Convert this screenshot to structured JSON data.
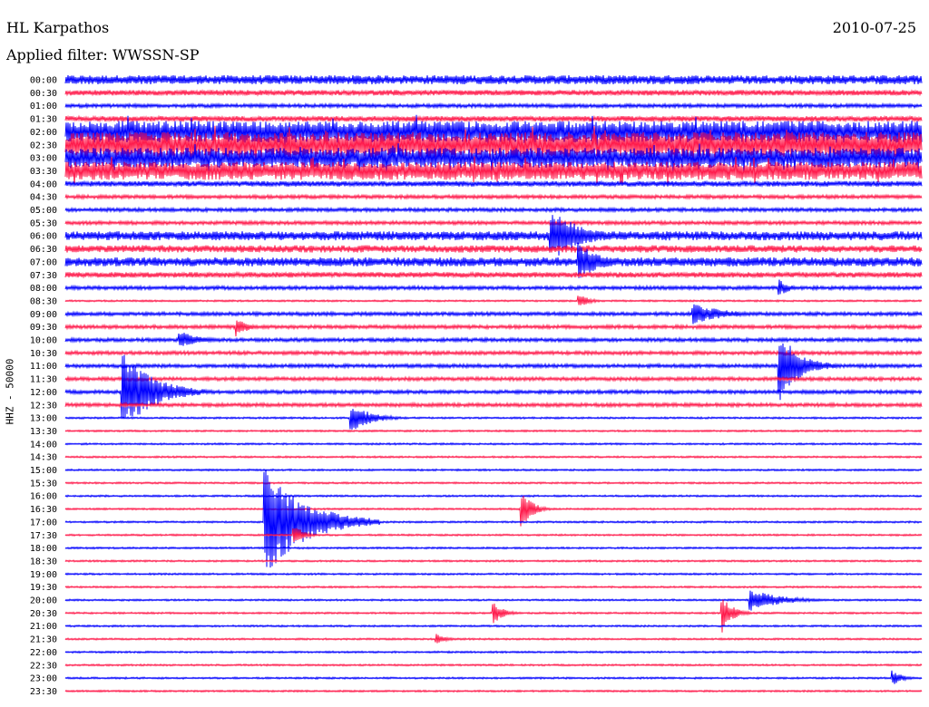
{
  "header": {
    "station": "HL Karpathos",
    "date": "2010-07-25",
    "filter_label": "Applied filter: WWSSN-SP"
  },
  "chart_data": {
    "type": "helicorder",
    "ylabel": "HHZ - 50000",
    "row_minutes": 30,
    "colors": [
      "#0000ff",
      "#ff1a4b"
    ],
    "rows": [
      "00:00",
      "00:30",
      "01:00",
      "01:30",
      "02:00",
      "02:30",
      "03:00",
      "03:30",
      "04:00",
      "04:30",
      "05:00",
      "05:30",
      "06:00",
      "06:30",
      "07:00",
      "07:30",
      "08:00",
      "08:30",
      "09:00",
      "09:30",
      "10:00",
      "10:30",
      "11:00",
      "11:30",
      "12:00",
      "12:30",
      "13:00",
      "13:30",
      "14:00",
      "14:30",
      "15:00",
      "15:30",
      "16:00",
      "16:30",
      "17:00",
      "17:30",
      "18:00",
      "18:30",
      "19:00",
      "19:30",
      "20:00",
      "20:30",
      "21:00",
      "21:30",
      "22:00",
      "22:30",
      "23:00",
      "23:30"
    ],
    "noise_level": [
      5,
      3,
      2,
      3,
      12,
      14,
      11,
      10,
      3,
      2,
      2,
      2,
      5,
      4,
      5,
      3,
      2,
      1,
      2,
      2,
      2,
      2,
      2,
      2,
      2,
      2,
      1,
      1,
      1,
      1,
      1,
      1,
      1,
      1,
      1,
      1,
      1,
      1,
      1,
      1,
      1,
      1,
      1,
      1,
      1,
      1,
      1,
      1
    ],
    "events": [
      {
        "row": 12,
        "minute": 17,
        "amplitude": 30,
        "duration_min": 3
      },
      {
        "row": 14,
        "minute": 18,
        "amplitude": 22,
        "duration_min": 2
      },
      {
        "row": 18,
        "minute": 22,
        "amplitude": 12,
        "duration_min": 3
      },
      {
        "row": 19,
        "minute": 6,
        "amplitude": 12,
        "duration_min": 1
      },
      {
        "row": 16,
        "minute": 25,
        "amplitude": 10,
        "duration_min": 1
      },
      {
        "row": 17,
        "minute": 18,
        "amplitude": 8,
        "duration_min": 1
      },
      {
        "row": 24,
        "minute": 2,
        "amplitude": 45,
        "duration_min": 3
      },
      {
        "row": 20,
        "minute": 4,
        "amplitude": 10,
        "duration_min": 2
      },
      {
        "row": 22,
        "minute": 25,
        "amplitude": 40,
        "duration_min": 2
      },
      {
        "row": 26,
        "minute": 10,
        "amplitude": 16,
        "duration_min": 2
      },
      {
        "row": 33,
        "minute": 16,
        "amplitude": 22,
        "duration_min": 1
      },
      {
        "row": 34,
        "minute": 7,
        "amplitude": 60,
        "duration_min": 4
      },
      {
        "row": 35,
        "minute": 8,
        "amplitude": 12,
        "duration_min": 1
      },
      {
        "row": 40,
        "minute": 24,
        "amplitude": 12,
        "duration_min": 3
      },
      {
        "row": 41,
        "minute": 23,
        "amplitude": 22,
        "duration_min": 1
      },
      {
        "row": 41,
        "minute": 15,
        "amplitude": 12,
        "duration_min": 1
      },
      {
        "row": 43,
        "minute": 13,
        "amplitude": 6,
        "duration_min": 1
      },
      {
        "row": 46,
        "minute": 29,
        "amplitude": 8,
        "duration_min": 1
      }
    ]
  }
}
